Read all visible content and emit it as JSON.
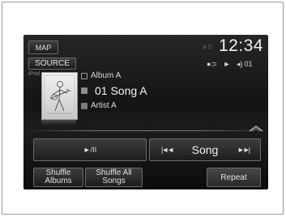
{
  "header": {
    "map_label": "MAP",
    "clock": "12:34",
    "source_label": "SOURCE",
    "bluetooth_dim": "∗0",
    "track_number": "01",
    "phone_tag": "iPod"
  },
  "now_playing": {
    "album": "Album A",
    "song": "01 Song A",
    "artist": "Artist A"
  },
  "controls": {
    "play_pause_label": "►/II",
    "prev_icon": "|◄◄",
    "song_label": "Song",
    "next_icon": "►►|"
  },
  "bottom": {
    "shuffle_albums_line1": "Shuffle",
    "shuffle_albums_line2": "Albums",
    "shuffle_all_line1": "Shuffle All",
    "shuffle_all_line2": "Songs",
    "repeat_label": "Repeat"
  },
  "colors": {
    "screen_bg": "#141414",
    "button_bg": "#2d2d2d",
    "text": "#e8e8e8"
  }
}
